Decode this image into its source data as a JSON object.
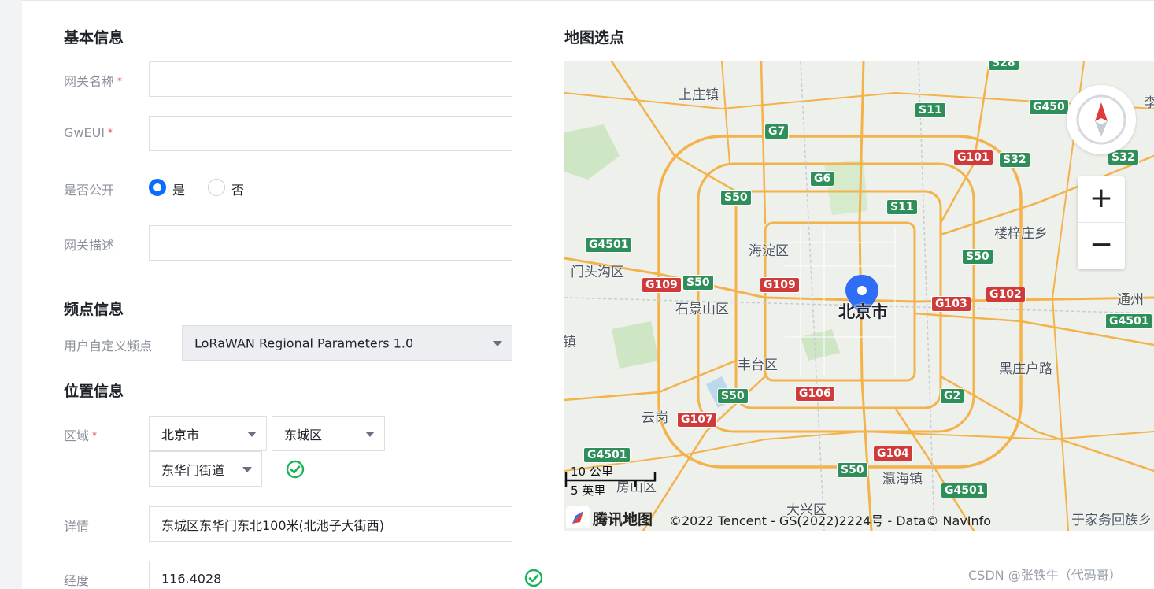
{
  "form": {
    "basic_title": "基本信息",
    "gateway_name_label": "网关名称",
    "gateway_name_value": "",
    "gweui_label": "GwEUI",
    "gweui_value": "",
    "public_label": "是否公开",
    "public_yes": "是",
    "public_no": "否",
    "public_selected": "是",
    "desc_label": "网关描述",
    "desc_value": "",
    "required_mark": "*",
    "freq_title": "频点信息",
    "freq_label": "用户自定义频点",
    "freq_value": "LoRaWAN Regional Parameters 1.0",
    "location_title": "位置信息",
    "region_label": "区域",
    "region_city": "北京市",
    "region_district": "东城区",
    "region_street": "东华门街道",
    "detail_label": "详情",
    "detail_value": "东城区东华门东北100米(北池子大街西)",
    "lng_label": "经度",
    "lng_value": "116.4028"
  },
  "map": {
    "title": "地图选点",
    "zoom_in": "+",
    "zoom_out": "−",
    "scale_km": "10 公里",
    "scale_mi": "5 英里",
    "brand": "腾讯地图",
    "copyright": "©2022 Tencent - GS(2022)2224号 - Data© NavInfo",
    "places": {
      "shangzhuang": "上庄镇",
      "haidian": "海淀区",
      "mentougou": "门头沟区",
      "shijingshan": "石景山区",
      "beijing": "北京市",
      "fengtai": "丰台区",
      "yungang": "云岗",
      "fangshan": "房山区",
      "daxing": "大兴区",
      "yinghai": "瀛海镇",
      "louzizhuang": "楼梓庄乡",
      "tongzhou": "通州",
      "heizhuanghu": "黑庄户路",
      "yujiawu": "于家务回族乡",
      "li": "李",
      "zhen": "镇"
    },
    "signs": {
      "s11a": "S11",
      "s11b": "S11",
      "g7": "G7",
      "g6": "G6",
      "s50a": "S50",
      "s50b": "S50",
      "s50c": "S50",
      "s50d": "S50",
      "s50e": "S50",
      "g4501a": "G4501",
      "g4501b": "G4501",
      "g4501c": "G4501",
      "g4501d": "G4501",
      "g109a": "G109",
      "g109b": "G109",
      "g101": "G101",
      "s32a": "S32",
      "s32b": "S32",
      "g450": "G450",
      "g103": "G103",
      "g102": "G102",
      "g106": "G106",
      "g107": "G107",
      "g104": "G104",
      "g2": "G2",
      "s28": "S28"
    }
  },
  "watermark": "CSDN @张铁牛（代码哥）",
  "colors": {
    "accent": "#0a6cff",
    "success": "#19b35a",
    "required": "#e54545",
    "road": "#f4b24a",
    "marker": "#2f6df6"
  }
}
